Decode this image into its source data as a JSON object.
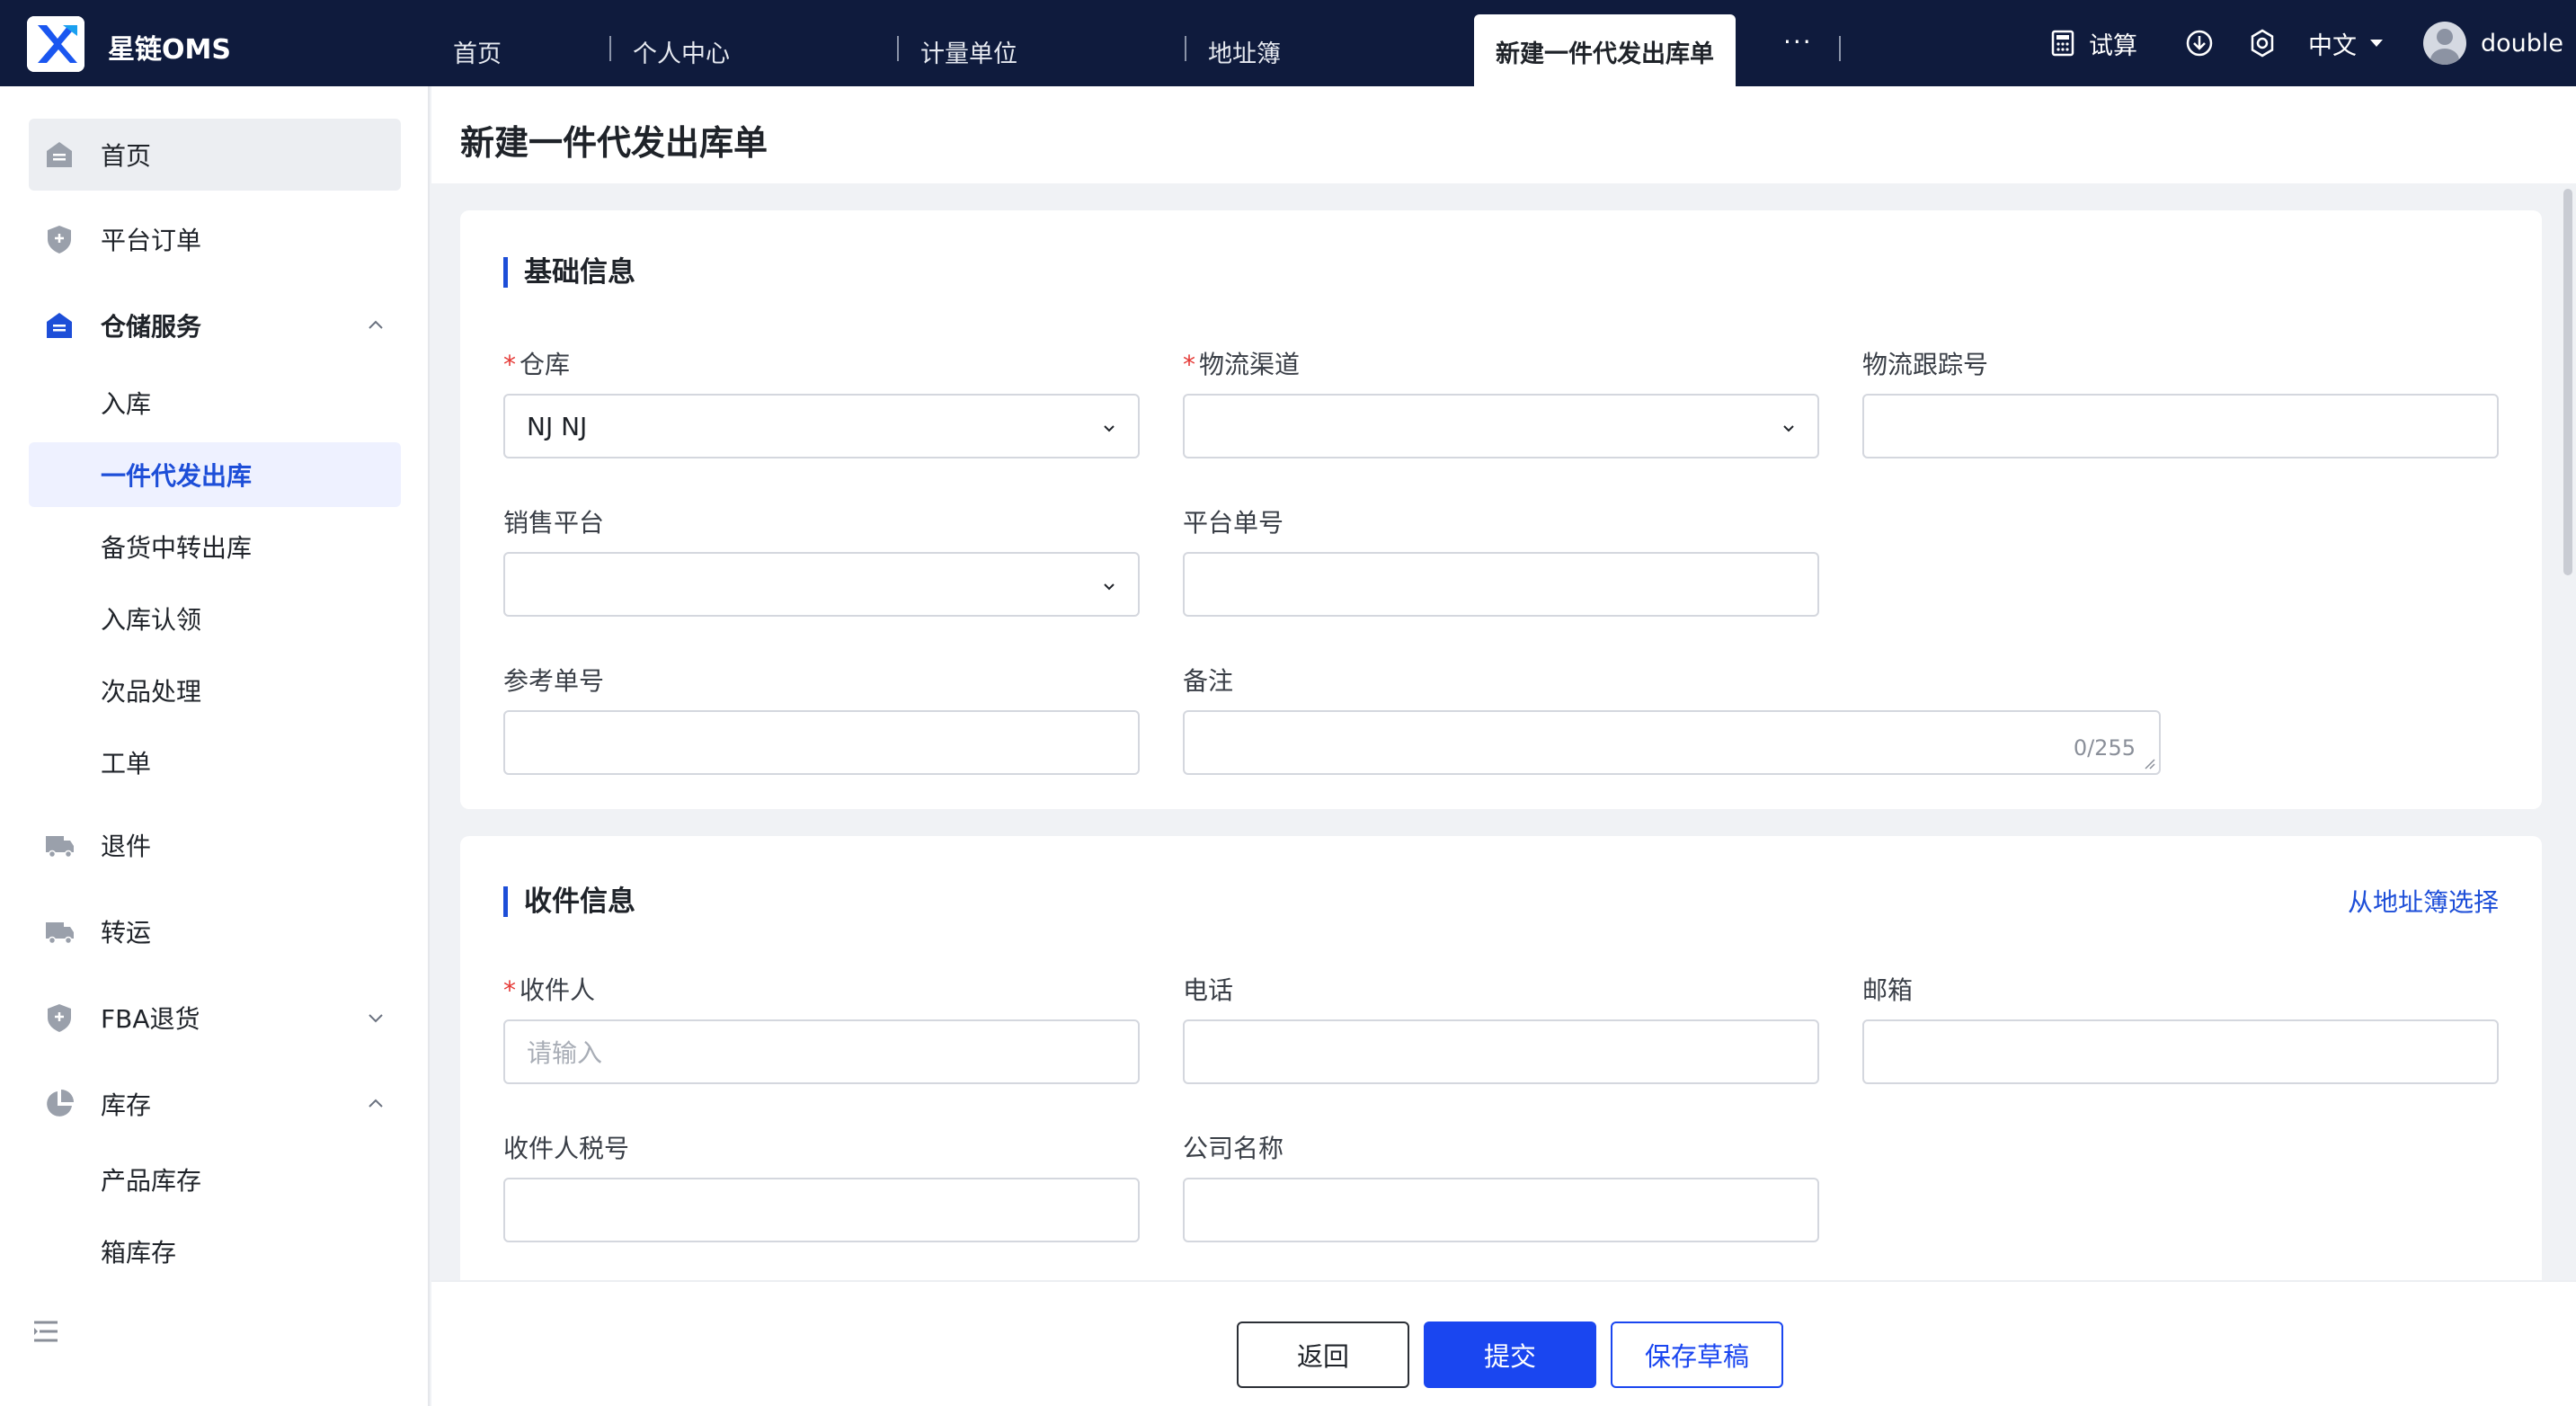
{
  "app": {
    "brand": "星链OMS"
  },
  "nav": {
    "tabs": [
      "首页",
      "个人中心",
      "计量单位",
      "地址簿"
    ],
    "active_tab": "新建一件代发出库单",
    "more": "···"
  },
  "topright": {
    "calc": "试算",
    "language": "中文",
    "user": "double"
  },
  "sidebar": {
    "home": "首页",
    "platform_orders": "平台订单",
    "warehouse_service": "仓储服务",
    "warehouse_sub": [
      "入库",
      "一件代发出库",
      "备货中转出库",
      "入库认领",
      "次品处理",
      "工单"
    ],
    "returns": "退件",
    "transfer": "转运",
    "fba_returns": "FBA退货",
    "inventory": "库存",
    "inventory_sub": [
      "产品库存",
      "箱库存"
    ]
  },
  "page": {
    "title": "新建一件代发出库单"
  },
  "basic": {
    "title": "基础信息",
    "warehouse_label": "仓库",
    "warehouse_value": "NJ NJ",
    "channel_label": "物流渠道",
    "tracking_label": "物流跟踪号",
    "platform_label": "销售平台",
    "platform_order_label": "平台单号",
    "reference_label": "参考单号",
    "remark_label": "备注",
    "remark_counter": "0/255"
  },
  "receiver": {
    "title": "收件信息",
    "address_book_link": "从地址簿选择",
    "name_label": "收件人",
    "name_placeholder": "请输入",
    "phone_label": "电话",
    "email_label": "邮箱",
    "tax_label": "收件人税号",
    "company_label": "公司名称"
  },
  "footer": {
    "back": "返回",
    "submit": "提交",
    "save_draft": "保存草稿"
  },
  "colors": {
    "topbar": "#0f1b3d",
    "primary": "#1a46f0",
    "required": "#e53935"
  }
}
